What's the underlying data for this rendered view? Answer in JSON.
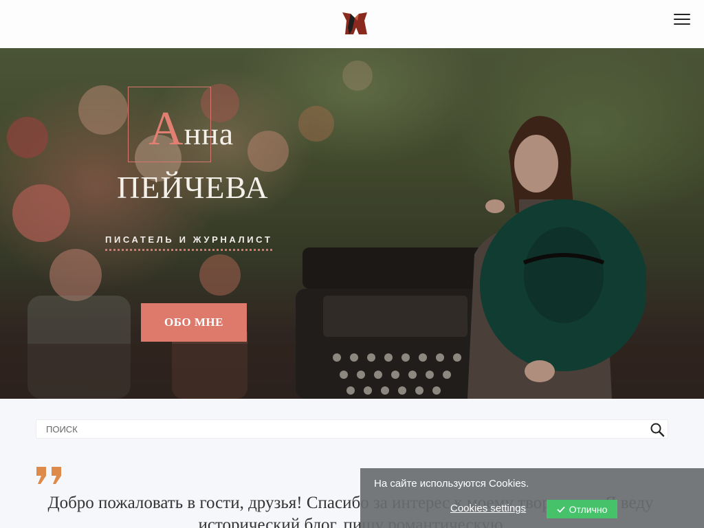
{
  "header": {
    "logo": "author-logo",
    "menu_icon": "hamburger-menu-icon"
  },
  "hero": {
    "title_first_letter": "А",
    "title_rest_line1": "нна",
    "title_line2": "ПЕЙЧЕВА",
    "subtitle": "ПИСАТЕЛЬ И ЖУРНАЛИСТ",
    "about_button": "ОБО МНЕ"
  },
  "search": {
    "placeholder": "ПОИСК",
    "icon": "search-icon"
  },
  "welcome": {
    "text": "Добро пожаловать в гости, друзья! Спасибо за интерес к моему творчеству. Я веду исторический блог, пишу романтическую"
  },
  "cookies": {
    "message": "На сайте используются Cookies.",
    "settings_label": "Cookies settings",
    "accept_label": "Отлично"
  },
  "colors": {
    "accent": "#dd7a6c",
    "accept_green": "#46c26b",
    "cookie_bg": "#696c70"
  }
}
